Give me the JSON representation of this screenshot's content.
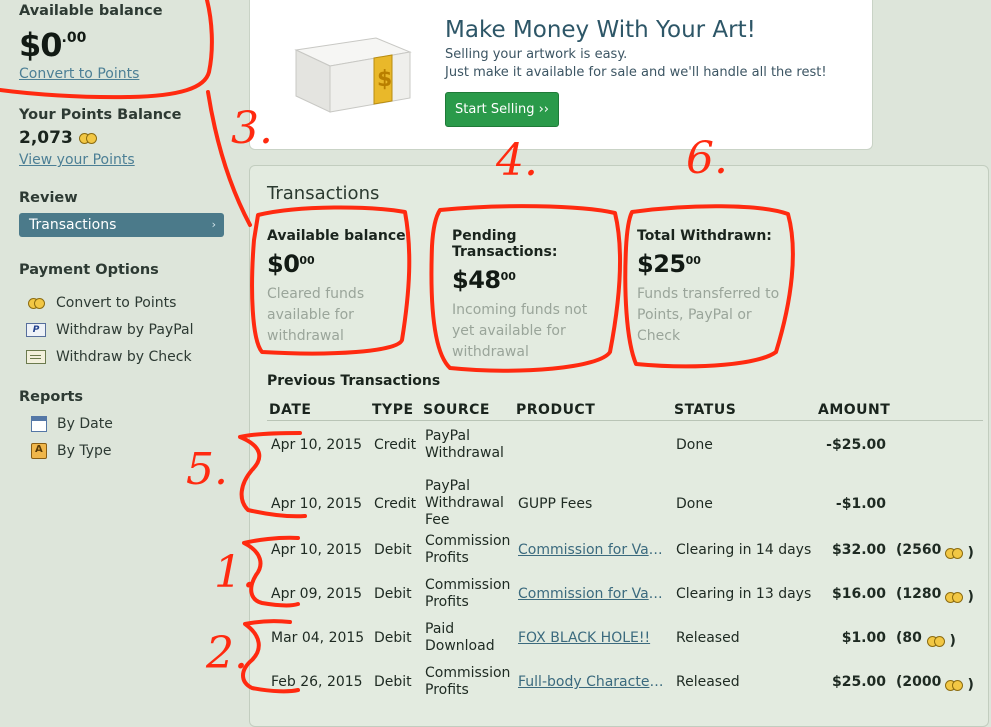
{
  "sidebar": {
    "available_balance_label": "Available balance",
    "available_balance_dollars": "$0",
    "available_balance_cents": ".00",
    "convert_link": "Convert to Points",
    "points_label": "Your Points Balance",
    "points_value": "2,073",
    "view_points_link": "View your Points",
    "review_heading": "Review",
    "review_items": [
      {
        "label": "Transactions",
        "active": true
      }
    ],
    "payment_heading": "Payment Options",
    "payment_items": [
      {
        "label": "Convert to Points",
        "icon": "coins-icon"
      },
      {
        "label": "Withdraw by PayPal",
        "icon": "paypal-icon"
      },
      {
        "label": "Withdraw by Check",
        "icon": "check-icon"
      }
    ],
    "reports_heading": "Reports",
    "report_items": [
      {
        "label": "By Date",
        "icon": "calendar-icon"
      },
      {
        "label": "By Type",
        "icon": "type-icon"
      }
    ]
  },
  "promo": {
    "title": "Make Money With Your Art!",
    "line1": "Selling your artwork is easy.",
    "line2": "Just make it available for sale and we'll handle all the rest!",
    "button": "Start Selling ››"
  },
  "transactions": {
    "title": "Transactions",
    "cards": [
      {
        "title": "Available balance:",
        "dollars": "$0",
        "cents": "00",
        "desc": [
          "Cleared funds",
          "available for",
          "withdrawal"
        ]
      },
      {
        "title": "Pending Transactions:",
        "dollars": "$48",
        "cents": "00",
        "desc": [
          "Incoming funds not",
          "yet available for",
          "withdrawal"
        ]
      },
      {
        "title": "Total Withdrawn:",
        "dollars": "$25",
        "cents": "00",
        "desc": [
          "Funds transferred to",
          "Points, PayPal or",
          "Check"
        ]
      }
    ],
    "previous_title": "Previous Transactions",
    "columns": [
      "DATE",
      "TYPE",
      "SOURCE",
      "PRODUCT",
      "STATUS",
      "AMOUNT"
    ],
    "rows": [
      {
        "date": "Apr 10, 2015",
        "type": "Credit",
        "source": [
          "PayPal",
          "Withdrawal"
        ],
        "product": "",
        "product_link": false,
        "status": "Done",
        "amount": "-$25.00",
        "points": ""
      },
      {
        "date": "Apr 10, 2015",
        "type": "Credit",
        "source": [
          "PayPal",
          "Withdrawal",
          "Fee"
        ],
        "product": "GUPP Fees",
        "product_link": false,
        "status": "Done",
        "amount": "-$1.00",
        "points": ""
      },
      {
        "date": "Apr 10, 2015",
        "type": "Debit",
        "source": [
          "Commission",
          "Profits"
        ],
        "product": "Commission for Various Things",
        "product_link": true,
        "status": "Clearing in 14 days",
        "amount": "$32.00",
        "points": "(2560"
      },
      {
        "date": "Apr 09, 2015",
        "type": "Debit",
        "source": [
          "Commission",
          "Profits"
        ],
        "product": "Commission for Various Things",
        "product_link": true,
        "status": "Clearing in 13 days",
        "amount": "$16.00",
        "points": "(1280"
      },
      {
        "date": "Mar 04, 2015",
        "type": "Debit",
        "source": [
          "Paid",
          "Download"
        ],
        "product": "FOX BLACK HOLE!!",
        "product_link": true,
        "status": "Released",
        "amount": "$1.00",
        "points": "(80"
      },
      {
        "date": "Feb 26, 2015",
        "type": "Debit",
        "source": [
          "Commission",
          "Profits"
        ],
        "product": "Full-body Character Commission",
        "product_link": true,
        "status": "Released",
        "amount": "$25.00",
        "points": "(2000"
      }
    ]
  },
  "annotations": [
    "3.",
    "4.",
    "6.",
    "5.",
    "1.",
    "2."
  ],
  "colors": {
    "annotation": "#ff2a10",
    "accent": "#4b7a8a",
    "button": "#2a9a4a",
    "link": "#4c7f95"
  }
}
